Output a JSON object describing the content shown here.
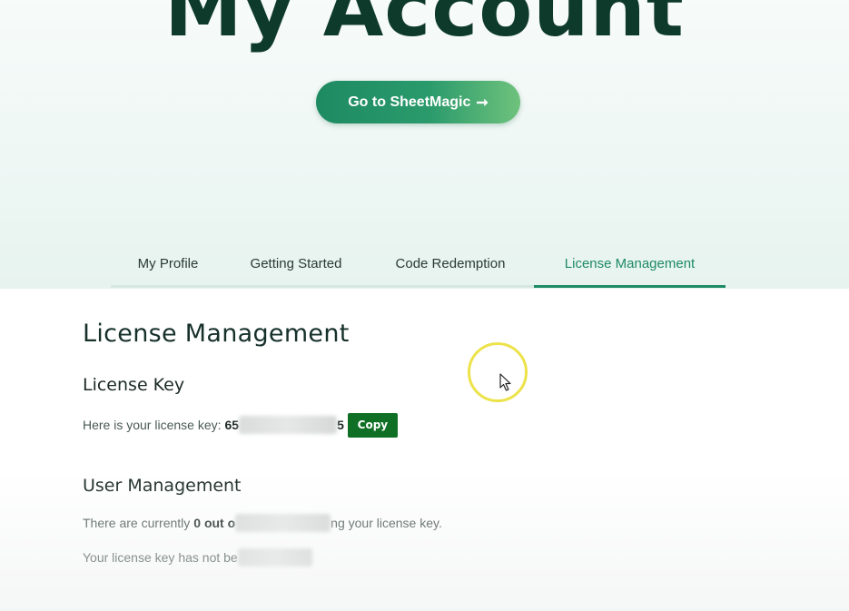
{
  "header": {
    "title": "My Account",
    "cta_label": "Go to SheetMagic",
    "cta_arrow": "➞"
  },
  "tabs": [
    {
      "label": "My Profile",
      "active": false
    },
    {
      "label": "Getting Started",
      "active": false
    },
    {
      "label": "Code Redemption",
      "active": false
    },
    {
      "label": "License Management",
      "active": true
    }
  ],
  "license": {
    "section_title": "License Management",
    "key_heading": "License Key",
    "key_prefix_text": "Here is your license key:",
    "key_visible_start": "65",
    "key_visible_end": "5",
    "copy_label": "Copy"
  },
  "users": {
    "heading": "User Management",
    "line1_prefix": "There are currently",
    "line1_bold": "0 out o",
    "line1_suffix": "ng your license key.",
    "line2_prefix": "Your license key has not be"
  },
  "colors": {
    "accent": "#1d8a66",
    "copy_button": "#0f6f25",
    "title": "#0e3a2c",
    "cursor_highlight": "#ece34a"
  },
  "icons": {
    "cta_arrow": "arrow-right-icon",
    "cursor": "mouse-pointer-icon"
  }
}
